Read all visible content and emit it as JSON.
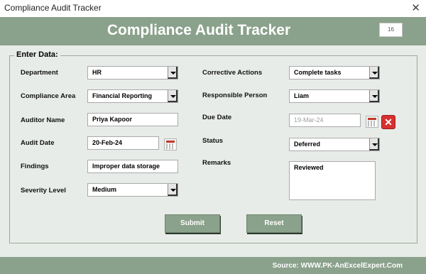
{
  "window": {
    "title": "Compliance Audit Tracker"
  },
  "header": {
    "title": "Compliance Audit Tracker",
    "counter": "16"
  },
  "form": {
    "group_label": "Enter Data:",
    "left": {
      "department": {
        "label": "Department",
        "value": "HR"
      },
      "compliance_area": {
        "label": "Compliance Area",
        "value": "Financial Reporting"
      },
      "auditor_name": {
        "label": "Auditor Name",
        "value": "Priya Kapoor"
      },
      "audit_date": {
        "label": "Audit Date",
        "value": "20-Feb-24"
      },
      "findings": {
        "label": "Findings",
        "value": "Improper data storage"
      },
      "severity_level": {
        "label": "Severity Level",
        "value": "Medium"
      }
    },
    "right": {
      "corrective_actions": {
        "label": "Corrective Actions",
        "value": "Complete tasks"
      },
      "responsible_person": {
        "label": "Responsible Person",
        "value": "Liam"
      },
      "due_date": {
        "label": "Due Date",
        "value": "19-Mar-24"
      },
      "status": {
        "label": "Status",
        "value": "Deferred"
      },
      "remarks": {
        "label": "Remarks",
        "value": "Reviewed"
      }
    }
  },
  "buttons": {
    "submit": "Submit",
    "reset": "Reset"
  },
  "footer": {
    "text": "Source: WWW.PK-AnExcelExpert.Com"
  },
  "colors": {
    "accent": "#8aa18b",
    "background": "#e8ece8",
    "clear_button": "#d63030"
  },
  "icons": {
    "close": "close-icon",
    "calendar": "calendar-icon",
    "clear": "clear-date-icon",
    "dropdown": "chevron-down-icon"
  }
}
